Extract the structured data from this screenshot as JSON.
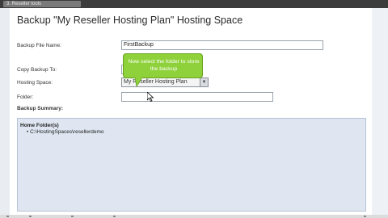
{
  "window": {
    "tab_label": "3. Reseller tools"
  },
  "page": {
    "title": "Backup \"My Reseller Hosting Plan\" Hosting Space"
  },
  "form": {
    "file_name_label": "Backup File Name:",
    "file_name_value": "FirstBackup",
    "copy_to_label": "Copy Backup To:",
    "hosting_space_label": "Hosting Space:",
    "hosting_space_value": "My Reseller Hosting Plan",
    "folder_label": "Folder:",
    "folder_value": ""
  },
  "summary": {
    "label": "Backup Summary:",
    "heading": "Home Folder(s)",
    "items": [
      "C:\\HostingSpaces\\resellerdemo"
    ]
  },
  "tooltip": {
    "text": "Now select the folder to store the backup"
  },
  "colors": {
    "tooltip_green": "#8ed13a",
    "summary_bg": "#dfe6f1"
  }
}
